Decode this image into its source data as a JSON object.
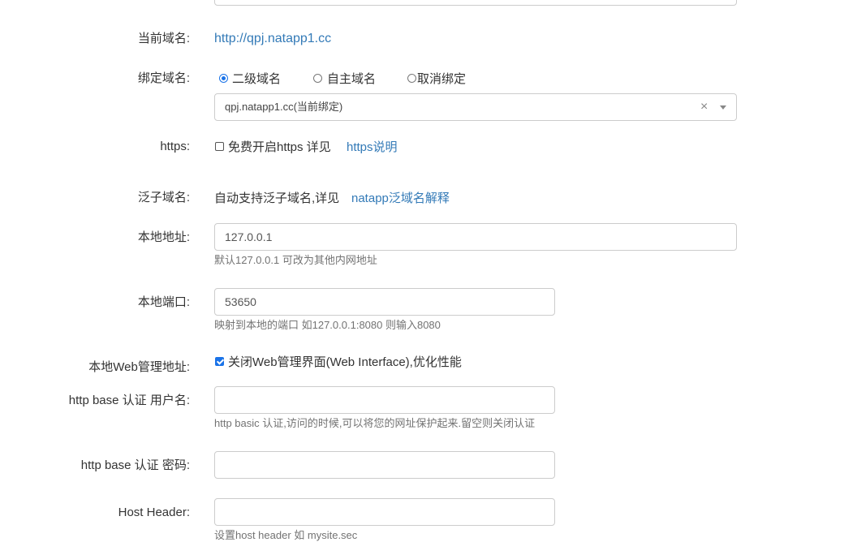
{
  "current_domain": {
    "label": "当前域名:",
    "value": "http://qpj.natapp1.cc"
  },
  "bind_domain": {
    "label": "绑定域名:",
    "options": [
      {
        "label": "二级域名",
        "checked": true
      },
      {
        "label": "自主域名",
        "checked": false
      },
      {
        "label": "取消绑定",
        "checked": false
      }
    ],
    "select_value": "qpj.natapp1.cc(当前绑定)",
    "clear_glyph": "×"
  },
  "https": {
    "label": "https:",
    "checkbox_text": "免费开启https 详见",
    "link": "https说明",
    "checked": false
  },
  "wildcard": {
    "label": "泛子域名:",
    "text": "自动支持泛子域名,详见",
    "link": "natapp泛域名解释"
  },
  "local_address": {
    "label": "本地地址:",
    "value": "127.0.0.1",
    "help": "默认127.0.0.1 可改为其他内网地址"
  },
  "local_port": {
    "label": "本地端口:",
    "value": "53650",
    "help": "映射到本地的端口 如127.0.0.1:8080 则输入8080"
  },
  "web_admin": {
    "label": "本地Web管理地址:",
    "checkbox_text": "关闭Web管理界面(Web Interface),优化性能",
    "checked": true
  },
  "auth_user": {
    "label": "http base 认证 用户名:",
    "value": "",
    "help": "http basic 认证,访问的时候,可以将您的网址保护起来.留空则关闭认证"
  },
  "auth_pass": {
    "label": "http base 认证 密码:",
    "value": ""
  },
  "host_header": {
    "label": "Host Header:",
    "value": "",
    "help": "设置host header 如 mysite.sec"
  }
}
